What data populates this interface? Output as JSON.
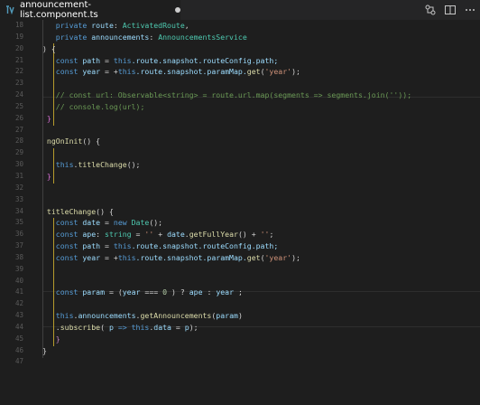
{
  "tab": {
    "title": "announcement-list.component.ts",
    "modified": true
  },
  "editor": {
    "line_numbers": [
      "18",
      "19",
      "20",
      "21",
      "22",
      "23",
      "24",
      "25",
      "26",
      "27",
      "28",
      "29",
      "30",
      "31",
      "32",
      "33",
      "34",
      "35",
      "36",
      "37",
      "38",
      "39",
      "40",
      "41",
      "42",
      "43",
      "44",
      "45",
      "46",
      "47"
    ],
    "lines": [
      [
        [
          "   private ",
          "kw"
        ],
        [
          "route",
          "vr"
        ],
        [
          ": ",
          "pu"
        ],
        [
          "ActivatedRoute",
          "ty"
        ],
        [
          ",",
          "pu"
        ]
      ],
      [
        [
          "   private ",
          "kw"
        ],
        [
          "announcements",
          "vr"
        ],
        [
          ": ",
          "pu"
        ],
        [
          "AnnouncementsService",
          "ty"
        ]
      ],
      [
        [
          ") {",
          "pu"
        ]
      ],
      [
        [
          "   const ",
          "kw"
        ],
        [
          "path",
          "vr"
        ],
        [
          " = ",
          "pu"
        ],
        [
          "this",
          "kw"
        ],
        [
          ".route.snapshot.routeConfig.path;",
          "vr"
        ]
      ],
      [
        [
          "   const ",
          "kw"
        ],
        [
          "year",
          "vr"
        ],
        [
          " = +",
          "pu"
        ],
        [
          "this",
          "kw"
        ],
        [
          ".route.snapshot.paramMap.",
          "vr"
        ],
        [
          "get",
          "fn"
        ],
        [
          "(",
          "pu"
        ],
        [
          "'year'",
          "st"
        ],
        [
          ");",
          "pu"
        ]
      ],
      [
        [
          "",
          "pu"
        ]
      ],
      [
        [
          "   // const url: Observable<string> = route.url.map(segments => segments.join(''));",
          "cm"
        ]
      ],
      [
        [
          "   // console.log(url);",
          "cm"
        ]
      ],
      [
        [
          " }",
          "br"
        ]
      ],
      [
        [
          "",
          "pu"
        ]
      ],
      [
        [
          " ngOnInit",
          "fn"
        ],
        [
          "() {",
          "pu"
        ]
      ],
      [
        [
          "",
          "pu"
        ]
      ],
      [
        [
          "   this",
          "kw"
        ],
        [
          ".",
          "pu"
        ],
        [
          "titleChange",
          "fn"
        ],
        [
          "();",
          "pu"
        ]
      ],
      [
        [
          " }",
          "br"
        ]
      ],
      [
        [
          "",
          "pu"
        ]
      ],
      [
        [
          "",
          "pu"
        ]
      ],
      [
        [
          " titleChange",
          "fn"
        ],
        [
          "() {",
          "pu"
        ]
      ],
      [
        [
          "   const ",
          "kw"
        ],
        [
          "date",
          "vr"
        ],
        [
          " = ",
          "pu"
        ],
        [
          "new ",
          "kw"
        ],
        [
          "Date",
          "ty"
        ],
        [
          "();",
          "pu"
        ]
      ],
      [
        [
          "   const ",
          "kw"
        ],
        [
          "ape",
          "vr"
        ],
        [
          ": ",
          "pu"
        ],
        [
          "string",
          "ty"
        ],
        [
          " = ",
          "pu"
        ],
        [
          "''",
          "st"
        ],
        [
          " + ",
          "pu"
        ],
        [
          "date",
          "vr"
        ],
        [
          ".",
          "pu"
        ],
        [
          "getFullYear",
          "fn"
        ],
        [
          "() + ",
          "pu"
        ],
        [
          "''",
          "st"
        ],
        [
          ";",
          "pu"
        ]
      ],
      [
        [
          "   const ",
          "kw"
        ],
        [
          "path",
          "vr"
        ],
        [
          " = ",
          "pu"
        ],
        [
          "this",
          "kw"
        ],
        [
          ".route.snapshot.routeConfig.path;",
          "vr"
        ]
      ],
      [
        [
          "   const ",
          "kw"
        ],
        [
          "year",
          "vr"
        ],
        [
          " = +",
          "pu"
        ],
        [
          "this",
          "kw"
        ],
        [
          ".route.snapshot.paramMap.",
          "vr"
        ],
        [
          "get",
          "fn"
        ],
        [
          "(",
          "pu"
        ],
        [
          "'year'",
          "st"
        ],
        [
          ");",
          "pu"
        ]
      ],
      [
        [
          "",
          "pu"
        ]
      ],
      [
        [
          "",
          "pu"
        ]
      ],
      [
        [
          "   const ",
          "kw"
        ],
        [
          "param",
          "vr"
        ],
        [
          " = (",
          "pu"
        ],
        [
          "year",
          "vr"
        ],
        [
          " === ",
          "pu"
        ],
        [
          "0",
          "nm"
        ],
        [
          " ) ? ",
          "pu"
        ],
        [
          "ape",
          "vr"
        ],
        [
          " : ",
          "pu"
        ],
        [
          "year",
          "vr"
        ],
        [
          " ;",
          "pu"
        ]
      ],
      [
        [
          "",
          "pu"
        ]
      ],
      [
        [
          "   this",
          "kw"
        ],
        [
          ".",
          "pu"
        ],
        [
          "announcements",
          "vr"
        ],
        [
          ".",
          "pu"
        ],
        [
          "getAnnouncements",
          "fn"
        ],
        [
          "(",
          "pu"
        ],
        [
          "param",
          "vr"
        ],
        [
          ")",
          "pu"
        ]
      ],
      [
        [
          "   .",
          "pu"
        ],
        [
          "subscribe",
          "fn"
        ],
        [
          "( ",
          "pu"
        ],
        [
          "p",
          "vr"
        ],
        [
          " => ",
          "kw"
        ],
        [
          "this",
          "kw"
        ],
        [
          ".",
          "pu"
        ],
        [
          "data",
          "vr"
        ],
        [
          " = ",
          "pu"
        ],
        [
          "p",
          "vr"
        ],
        [
          ");",
          "pu"
        ]
      ],
      [
        [
          "   }",
          "fd"
        ]
      ],
      [
        [
          "}",
          "pu"
        ]
      ],
      [
        [
          "",
          "pu"
        ]
      ]
    ]
  },
  "icons": {
    "file": "typescript-file-icon",
    "compare": "compare-changes-icon",
    "split": "split-editor-icon",
    "more": "more-actions-icon"
  },
  "colors": {
    "background": "#1e1e1e",
    "tabbar": "#252526",
    "keyword": "#569cd6",
    "type": "#4ec9b0",
    "string": "#ce9178",
    "comment": "#6a9955",
    "function": "#dcdcaa",
    "variable": "#9cdcfe"
  }
}
